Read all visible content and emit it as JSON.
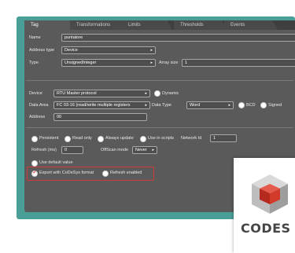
{
  "tabs": [
    "Tag",
    "Transformations",
    "Limits",
    "Thresholds",
    "Events"
  ],
  "general": {
    "name_label": "Name",
    "name_value": "puntatore",
    "address_type_label": "Address type",
    "address_type_value": "Device",
    "type_label": "Type",
    "type_value": "UnsignedInteger",
    "array_size_label": "Array size",
    "array_size_value": "1"
  },
  "device": {
    "device_label": "Device",
    "device_value": "RTU Master protocol",
    "dynamic_label": "Dynamic",
    "data_area_label": "Data Area",
    "data_area_value": "FC 03-16 (read/write multiple registers",
    "data_type_label": "Data Type",
    "data_type_value": "Word",
    "bcd_label": "BCD",
    "signed_label": "Signed",
    "address_label": "Address",
    "address_value": "00"
  },
  "options": {
    "persistent_label": "Persistent",
    "read_only_label": "Read only",
    "always_update_label": "Always update",
    "use_in_scripts_label": "Use in scripts",
    "network_id_label": "Network Id",
    "network_id_value": "1",
    "refresh_label": "Refresh (ms)",
    "refresh_value": "0",
    "offscan_label": "OffScan mode",
    "offscan_value": "Never",
    "use_default_label": "Use default value",
    "export_label": "Export with CoDeSys format",
    "export_checked": true,
    "refresh_enabled_label": "Refresh enabled"
  },
  "logo": {
    "text": "CODES"
  },
  "colors": {
    "panel": "#5a5a5a",
    "frame": "#4a9e98",
    "highlight": "#d23a3a"
  }
}
